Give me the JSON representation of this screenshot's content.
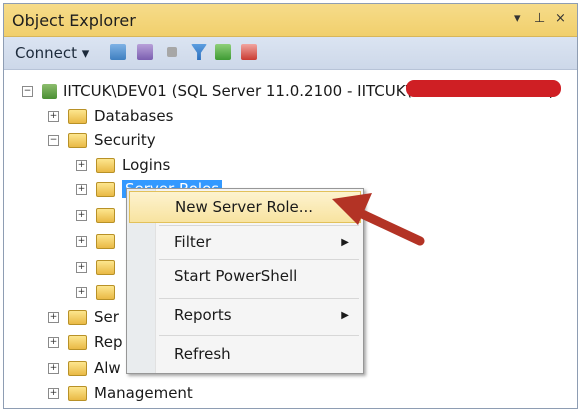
{
  "panel": {
    "title": "Object Explorer",
    "dock_icons": [
      "pin-icon",
      "close-icon"
    ],
    "pin_symbol": "▾ ⊥ ×"
  },
  "toolbar": {
    "connect_label": "Connect ▾"
  },
  "tree": {
    "server_label": "IITCUK\\DEV01 (SQL Server 11.0.2100 - IITCUK\\",
    "server_label_tail": ")",
    "databases": "Databases",
    "security": "Security",
    "logins": "Logins",
    "server_roles": "Server Roles",
    "server_objects": "Ser",
    "replication": "Rep",
    "always_on": "Alw",
    "management": "Management"
  },
  "context_menu": {
    "items": [
      {
        "label": "New Server Role..."
      },
      {
        "label": "Filter"
      },
      {
        "label": "Start PowerShell"
      },
      {
        "label": "Reports"
      },
      {
        "label": "Refresh"
      }
    ],
    "highlight_color": "#f8e3a0"
  },
  "colors": {
    "accent": "#3399ff",
    "titlebar": "#f1cf6c",
    "arrow": "#b33325",
    "redaction": "#cf1f24"
  }
}
